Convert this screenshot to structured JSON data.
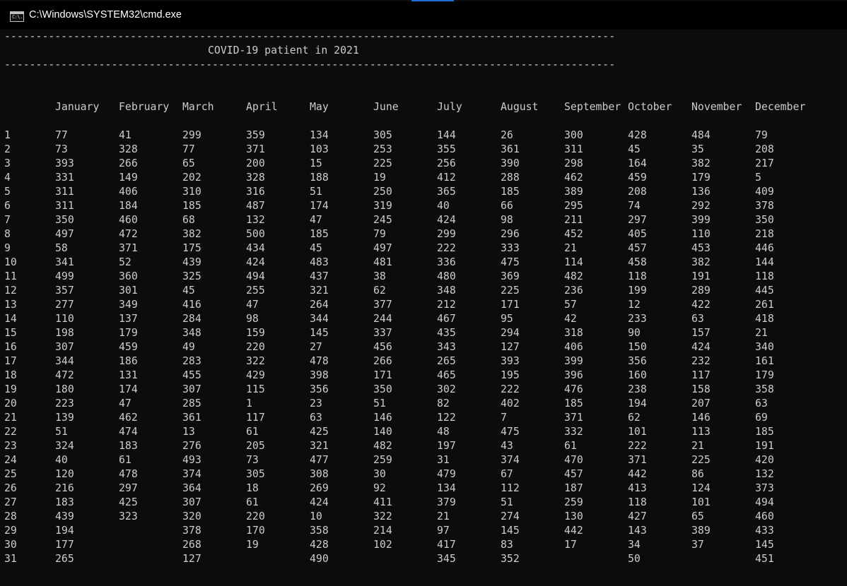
{
  "window": {
    "title": "C:\\Windows\\SYSTEM32\\cmd.exe",
    "icon": "cmd-icon",
    "icon_glyph": "C:\\."
  },
  "console": {
    "separator": "-------------------------------------------------------------------------------------------------",
    "heading": "COVID-19 patient in 2021",
    "months": [
      "January",
      "February",
      "March",
      "April",
      "May",
      "June",
      "July",
      "August",
      "September",
      "October",
      "November",
      "December"
    ],
    "rows": [
      [
        "1",
        "77",
        "41",
        "299",
        "359",
        "134",
        "305",
        "144",
        "26",
        "300",
        "428",
        "484",
        "79"
      ],
      [
        "2",
        "73",
        "328",
        "77",
        "371",
        "103",
        "253",
        "355",
        "361",
        "311",
        "45",
        "35",
        "208"
      ],
      [
        "3",
        "393",
        "266",
        "65",
        "200",
        "15",
        "225",
        "256",
        "390",
        "298",
        "164",
        "382",
        "217"
      ],
      [
        "4",
        "331",
        "149",
        "202",
        "328",
        "188",
        "19",
        "412",
        "288",
        "462",
        "459",
        "179",
        "5"
      ],
      [
        "5",
        "311",
        "406",
        "310",
        "316",
        "51",
        "250",
        "365",
        "185",
        "389",
        "208",
        "136",
        "409"
      ],
      [
        "6",
        "311",
        "184",
        "185",
        "487",
        "174",
        "319",
        "40",
        "66",
        "295",
        "74",
        "292",
        "378"
      ],
      [
        "7",
        "350",
        "460",
        "68",
        "132",
        "47",
        "245",
        "424",
        "98",
        "211",
        "297",
        "399",
        "350"
      ],
      [
        "8",
        "497",
        "472",
        "382",
        "500",
        "185",
        "79",
        "299",
        "296",
        "452",
        "405",
        "110",
        "218"
      ],
      [
        "9",
        "58",
        "371",
        "175",
        "434",
        "45",
        "497",
        "222",
        "333",
        "21",
        "457",
        "453",
        "446"
      ],
      [
        "10",
        "341",
        "52",
        "439",
        "424",
        "483",
        "481",
        "336",
        "475",
        "114",
        "458",
        "382",
        "144"
      ],
      [
        "11",
        "499",
        "360",
        "325",
        "494",
        "437",
        "38",
        "480",
        "369",
        "482",
        "118",
        "191",
        "118"
      ],
      [
        "12",
        "357",
        "301",
        "45",
        "255",
        "321",
        "62",
        "348",
        "225",
        "236",
        "199",
        "289",
        "445"
      ],
      [
        "13",
        "277",
        "349",
        "416",
        "47",
        "264",
        "377",
        "212",
        "171",
        "57",
        "12",
        "422",
        "261"
      ],
      [
        "14",
        "110",
        "137",
        "284",
        "98",
        "344",
        "244",
        "467",
        "95",
        "42",
        "233",
        "63",
        "418"
      ],
      [
        "15",
        "198",
        "179",
        "348",
        "159",
        "145",
        "337",
        "435",
        "294",
        "318",
        "90",
        "157",
        "21"
      ],
      [
        "16",
        "307",
        "459",
        "49",
        "220",
        "27",
        "456",
        "343",
        "127",
        "406",
        "150",
        "424",
        "340"
      ],
      [
        "17",
        "344",
        "186",
        "283",
        "322",
        "478",
        "266",
        "265",
        "393",
        "399",
        "356",
        "232",
        "161"
      ],
      [
        "18",
        "472",
        "131",
        "455",
        "429",
        "398",
        "171",
        "465",
        "195",
        "396",
        "160",
        "117",
        "179"
      ],
      [
        "19",
        "180",
        "174",
        "307",
        "115",
        "356",
        "350",
        "302",
        "222",
        "476",
        "238",
        "158",
        "358"
      ],
      [
        "20",
        "223",
        "47",
        "285",
        "1",
        "23",
        "51",
        "82",
        "402",
        "185",
        "194",
        "207",
        "63"
      ],
      [
        "21",
        "139",
        "462",
        "361",
        "117",
        "63",
        "146",
        "122",
        "7",
        "371",
        "62",
        "146",
        "69"
      ],
      [
        "22",
        "51",
        "474",
        "13",
        "61",
        "425",
        "140",
        "48",
        "475",
        "332",
        "101",
        "113",
        "185"
      ],
      [
        "23",
        "324",
        "183",
        "276",
        "205",
        "321",
        "482",
        "197",
        "43",
        "61",
        "222",
        "21",
        "191"
      ],
      [
        "24",
        "40",
        "61",
        "493",
        "73",
        "477",
        "259",
        "31",
        "374",
        "470",
        "371",
        "225",
        "420"
      ],
      [
        "25",
        "120",
        "478",
        "374",
        "305",
        "308",
        "30",
        "479",
        "67",
        "457",
        "442",
        "86",
        "132"
      ],
      [
        "26",
        "216",
        "297",
        "364",
        "18",
        "269",
        "92",
        "134",
        "112",
        "187",
        "413",
        "124",
        "373"
      ],
      [
        "27",
        "183",
        "425",
        "307",
        "61",
        "424",
        "411",
        "379",
        "51",
        "259",
        "118",
        "101",
        "494"
      ],
      [
        "28",
        "439",
        "323",
        "320",
        "220",
        "10",
        "322",
        "21",
        "274",
        "130",
        "427",
        "65",
        "460"
      ],
      [
        "29",
        "194",
        "",
        "378",
        "170",
        "358",
        "214",
        "97",
        "145",
        "442",
        "143",
        "389",
        "433"
      ],
      [
        "30",
        "177",
        "",
        "268",
        "19",
        "428",
        "102",
        "417",
        "83",
        "17",
        "34",
        "37",
        "145"
      ],
      [
        "31",
        "265",
        "",
        "127",
        "",
        "490",
        "",
        "345",
        "352",
        "",
        "50",
        "",
        "451"
      ]
    ]
  }
}
